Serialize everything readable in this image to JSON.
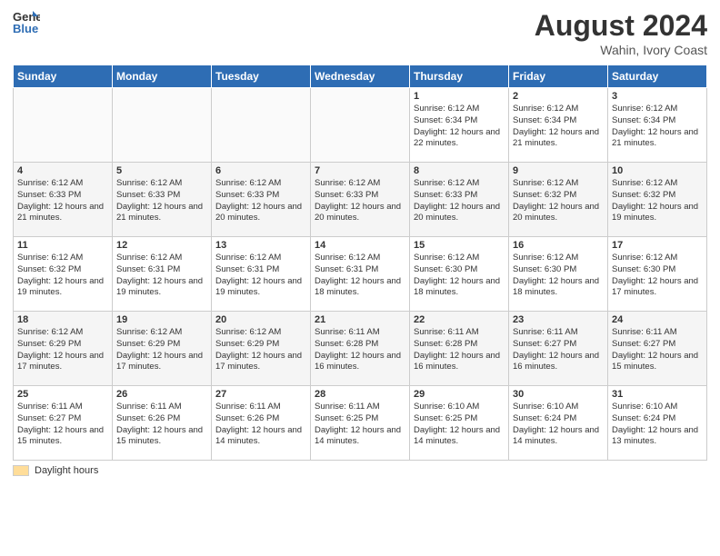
{
  "header": {
    "logo_general": "General",
    "logo_blue": "Blue",
    "month_year": "August 2024",
    "location": "Wahin, Ivory Coast"
  },
  "days_of_week": [
    "Sunday",
    "Monday",
    "Tuesday",
    "Wednesday",
    "Thursday",
    "Friday",
    "Saturday"
  ],
  "legend": {
    "label": "Daylight hours"
  },
  "weeks": [
    [
      {
        "day": "",
        "info": ""
      },
      {
        "day": "",
        "info": ""
      },
      {
        "day": "",
        "info": ""
      },
      {
        "day": "",
        "info": ""
      },
      {
        "day": "1",
        "info": "Sunrise: 6:12 AM\nSunset: 6:34 PM\nDaylight: 12 hours\nand 22 minutes."
      },
      {
        "day": "2",
        "info": "Sunrise: 6:12 AM\nSunset: 6:34 PM\nDaylight: 12 hours\nand 21 minutes."
      },
      {
        "day": "3",
        "info": "Sunrise: 6:12 AM\nSunset: 6:34 PM\nDaylight: 12 hours\nand 21 minutes."
      }
    ],
    [
      {
        "day": "4",
        "info": "Sunrise: 6:12 AM\nSunset: 6:33 PM\nDaylight: 12 hours\nand 21 minutes."
      },
      {
        "day": "5",
        "info": "Sunrise: 6:12 AM\nSunset: 6:33 PM\nDaylight: 12 hours\nand 21 minutes."
      },
      {
        "day": "6",
        "info": "Sunrise: 6:12 AM\nSunset: 6:33 PM\nDaylight: 12 hours\nand 20 minutes."
      },
      {
        "day": "7",
        "info": "Sunrise: 6:12 AM\nSunset: 6:33 PM\nDaylight: 12 hours\nand 20 minutes."
      },
      {
        "day": "8",
        "info": "Sunrise: 6:12 AM\nSunset: 6:33 PM\nDaylight: 12 hours\nand 20 minutes."
      },
      {
        "day": "9",
        "info": "Sunrise: 6:12 AM\nSunset: 6:32 PM\nDaylight: 12 hours\nand 20 minutes."
      },
      {
        "day": "10",
        "info": "Sunrise: 6:12 AM\nSunset: 6:32 PM\nDaylight: 12 hours\nand 19 minutes."
      }
    ],
    [
      {
        "day": "11",
        "info": "Sunrise: 6:12 AM\nSunset: 6:32 PM\nDaylight: 12 hours\nand 19 minutes."
      },
      {
        "day": "12",
        "info": "Sunrise: 6:12 AM\nSunset: 6:31 PM\nDaylight: 12 hours\nand 19 minutes."
      },
      {
        "day": "13",
        "info": "Sunrise: 6:12 AM\nSunset: 6:31 PM\nDaylight: 12 hours\nand 19 minutes."
      },
      {
        "day": "14",
        "info": "Sunrise: 6:12 AM\nSunset: 6:31 PM\nDaylight: 12 hours\nand 18 minutes."
      },
      {
        "day": "15",
        "info": "Sunrise: 6:12 AM\nSunset: 6:30 PM\nDaylight: 12 hours\nand 18 minutes."
      },
      {
        "day": "16",
        "info": "Sunrise: 6:12 AM\nSunset: 6:30 PM\nDaylight: 12 hours\nand 18 minutes."
      },
      {
        "day": "17",
        "info": "Sunrise: 6:12 AM\nSunset: 6:30 PM\nDaylight: 12 hours\nand 17 minutes."
      }
    ],
    [
      {
        "day": "18",
        "info": "Sunrise: 6:12 AM\nSunset: 6:29 PM\nDaylight: 12 hours\nand 17 minutes."
      },
      {
        "day": "19",
        "info": "Sunrise: 6:12 AM\nSunset: 6:29 PM\nDaylight: 12 hours\nand 17 minutes."
      },
      {
        "day": "20",
        "info": "Sunrise: 6:12 AM\nSunset: 6:29 PM\nDaylight: 12 hours\nand 17 minutes."
      },
      {
        "day": "21",
        "info": "Sunrise: 6:11 AM\nSunset: 6:28 PM\nDaylight: 12 hours\nand 16 minutes."
      },
      {
        "day": "22",
        "info": "Sunrise: 6:11 AM\nSunset: 6:28 PM\nDaylight: 12 hours\nand 16 minutes."
      },
      {
        "day": "23",
        "info": "Sunrise: 6:11 AM\nSunset: 6:27 PM\nDaylight: 12 hours\nand 16 minutes."
      },
      {
        "day": "24",
        "info": "Sunrise: 6:11 AM\nSunset: 6:27 PM\nDaylight: 12 hours\nand 15 minutes."
      }
    ],
    [
      {
        "day": "25",
        "info": "Sunrise: 6:11 AM\nSunset: 6:27 PM\nDaylight: 12 hours\nand 15 minutes."
      },
      {
        "day": "26",
        "info": "Sunrise: 6:11 AM\nSunset: 6:26 PM\nDaylight: 12 hours\nand 15 minutes."
      },
      {
        "day": "27",
        "info": "Sunrise: 6:11 AM\nSunset: 6:26 PM\nDaylight: 12 hours\nand 14 minutes."
      },
      {
        "day": "28",
        "info": "Sunrise: 6:11 AM\nSunset: 6:25 PM\nDaylight: 12 hours\nand 14 minutes."
      },
      {
        "day": "29",
        "info": "Sunrise: 6:10 AM\nSunset: 6:25 PM\nDaylight: 12 hours\nand 14 minutes."
      },
      {
        "day": "30",
        "info": "Sunrise: 6:10 AM\nSunset: 6:24 PM\nDaylight: 12 hours\nand 14 minutes."
      },
      {
        "day": "31",
        "info": "Sunrise: 6:10 AM\nSunset: 6:24 PM\nDaylight: 12 hours\nand 13 minutes."
      }
    ]
  ]
}
